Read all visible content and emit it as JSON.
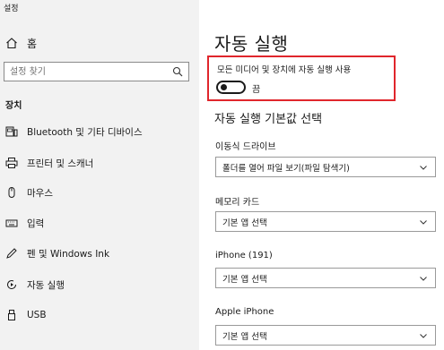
{
  "app": {
    "title": "설정"
  },
  "sidebar": {
    "home_label": "홈",
    "search_placeholder": "설정 찾기",
    "section_title": "장치",
    "items": [
      {
        "label": "Bluetooth 및 기타 디바이스",
        "icon": "bluetooth-devices-icon"
      },
      {
        "label": "프린터 및 스캐너",
        "icon": "printer-icon"
      },
      {
        "label": "마우스",
        "icon": "mouse-icon"
      },
      {
        "label": "입력",
        "icon": "keyboard-icon"
      },
      {
        "label": "펜 및 Windows Ink",
        "icon": "pen-icon"
      },
      {
        "label": "자동 실행",
        "icon": "autoplay-icon"
      },
      {
        "label": "USB",
        "icon": "usb-icon"
      }
    ]
  },
  "main": {
    "title": "자동 실행",
    "toggle": {
      "label": "모든 미디어 및 장치에 자동 실행 사용",
      "state_text": "끔",
      "on": false
    },
    "defaults_heading": "자동 실행 기본값 선택",
    "fields": [
      {
        "label": "이동식 드라이브",
        "value": "폴더를 열어 파일 보기(파일 탐색기)"
      },
      {
        "label": "메모리 카드",
        "value": "기본 앱 선택"
      },
      {
        "label": "iPhone (191)",
        "value": "기본 앱 선택"
      },
      {
        "label": "Apple iPhone",
        "value": "기본 앱 선택"
      }
    ]
  },
  "colors": {
    "highlight_border": "#e0262c",
    "sidebar_bg": "#f2f2f2"
  }
}
